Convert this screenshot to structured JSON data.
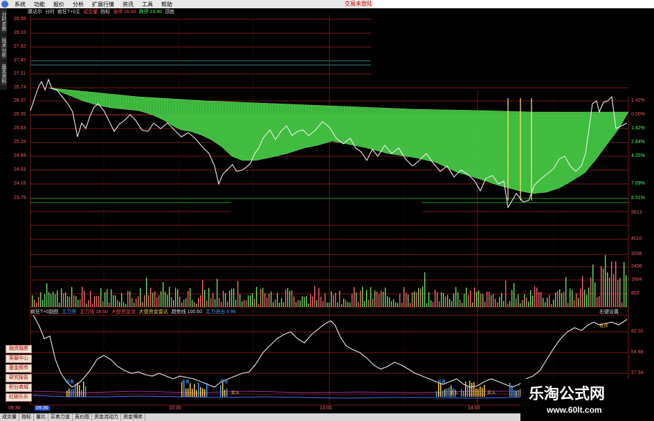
{
  "menu": {
    "items": [
      "系统",
      "功能",
      "报价",
      "分析",
      "扩展行情",
      "资讯",
      "工具",
      "帮助"
    ],
    "right_link": "交易未登陆"
  },
  "sidebar": {
    "tabs": [
      "分时走势",
      "技术分析",
      "基本资料"
    ]
  },
  "header": {
    "items": [
      {
        "text": "康达尔",
        "color": "w"
      },
      {
        "text": "分时",
        "color": "w"
      },
      {
        "text": "疯狂T+0主",
        "color": "w"
      },
      {
        "text": "成交量",
        "color": "red"
      },
      {
        "text": "指标",
        "color": "w"
      },
      {
        "text": "涨停 26.60",
        "color": "red"
      },
      {
        "text": "跌停 23.40",
        "color": "grn"
      },
      {
        "text": "顶底",
        "color": "w"
      }
    ]
  },
  "price_axis_left": [
    "28.59",
    "28.10",
    "27.62",
    "27.47",
    "27.11",
    "26.74",
    "26.37",
    "26.00",
    "25.63",
    "25.26",
    "24.89",
    "24.53",
    "24.16",
    "23.79"
  ],
  "pct_axis_right": [
    {
      "text": "1.42%",
      "color": "r"
    },
    {
      "text": "0.00%",
      "color": "r"
    },
    {
      "text": "1.42%",
      "color": "g"
    },
    {
      "text": "2.84%",
      "color": "g"
    },
    {
      "text": "4.25%",
      "color": "g"
    },
    {
      "text": "7.09%",
      "color": "g"
    },
    {
      "text": "8.51%",
      "color": "g"
    }
  ],
  "volume_axis_right": [
    "5613",
    "4010",
    "3208",
    "2406",
    "1604",
    "802"
  ],
  "indicator_header": [
    {
      "text": "疯狂T+0副图",
      "color": "w"
    },
    {
      "text": "主力资",
      "color": "b"
    },
    {
      "text": "主力线 18.50",
      "color": "r"
    },
    {
      "text": "大盘资金流",
      "color": "r"
    },
    {
      "text": "大盘资金雷达",
      "color": "y"
    },
    {
      "text": "趋势线 100.60",
      "color": "w"
    },
    {
      "text": "主力进出 3.96",
      "color": "b"
    }
  ],
  "indicator_settings": "右键设置",
  "indicator_axis_right": [
    "82.02",
    "54.68",
    "27.34"
  ],
  "signals": [
    {
      "text": "准备",
      "color": "#4aa0ff"
    },
    {
      "text": "准备",
      "color": "#4aa0ff"
    },
    {
      "text": "准备",
      "color": "#4aa0ff"
    },
    {
      "text": "准备",
      "color": "#4aa0ff"
    },
    {
      "text": "买入",
      "color": "#ffd24d"
    },
    {
      "text": "买入",
      "color": "#ffd24d"
    },
    {
      "text": "买入",
      "color": "#ffd24d"
    },
    {
      "text": "逃顶",
      "color": "#ffd24d"
    }
  ],
  "left_side_buttons": [
    "融资融券",
    "客服中心",
    "基金频市",
    "研究报告",
    "积分商城",
    "红碗乐乐"
  ],
  "time_axis": [
    "09:30",
    "10:30",
    "13:00",
    "14:00"
  ],
  "current_time": "09:36",
  "bottom_tabs": [
    "成交量",
    "指标",
    "量比",
    "买卖力道",
    "竞价图",
    "资金流动力",
    "资金博弈"
  ],
  "watermark": {
    "title": "乐淘公式网",
    "url": "www.60lt.com"
  }
}
